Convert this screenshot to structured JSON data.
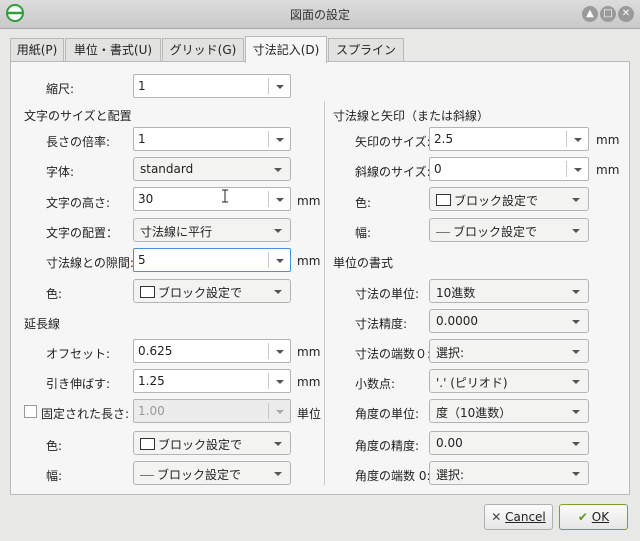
{
  "window": {
    "title": "図面の設定"
  },
  "tabs": [
    {
      "label": "用紙(P)"
    },
    {
      "label": "単位・書式(U)"
    },
    {
      "label": "グリッド(G)"
    },
    {
      "label": "寸法記入(D)",
      "active": true
    },
    {
      "label": "スプライン"
    }
  ],
  "scale": {
    "label": "縮尺:",
    "value": "1"
  },
  "text_section": {
    "title": "文字のサイズと配置",
    "length_factor": {
      "label": "長さの倍率:",
      "value": "1"
    },
    "font": {
      "label": "字体:",
      "value": "standard"
    },
    "text_height": {
      "label": "文字の高さ:",
      "value": "30",
      "unit": "mm"
    },
    "alignment": {
      "label": "文字の配置：",
      "value": "寸法線に平行"
    },
    "gap": {
      "label": "寸法線との隙間:",
      "value": "5",
      "unit": "mm"
    },
    "color": {
      "label": "色:",
      "value": "ブロック設定で"
    }
  },
  "extension_section": {
    "title": "延長線",
    "offset": {
      "label": "オフセット:",
      "value": "0.625",
      "unit": "mm"
    },
    "extend": {
      "label": "引き伸ばす:",
      "value": "1.25",
      "unit": "mm"
    },
    "fixed_length": {
      "label": "固定された長さ:",
      "value": "1.00",
      "unit": "単位",
      "checked": false
    },
    "color": {
      "label": "色:",
      "value": "ブロック設定で"
    },
    "width": {
      "label": "幅:",
      "value": "ブロック設定で"
    }
  },
  "arrow_section": {
    "title": "寸法線と矢印（または斜線）",
    "arrow_size": {
      "label": "矢印のサイズ:",
      "value": "2.5",
      "unit": "mm"
    },
    "tick_size": {
      "label": "斜線のサイズ:",
      "value": "0",
      "unit": "mm"
    },
    "color": {
      "label": "色:",
      "value": "ブロック設定で"
    },
    "width": {
      "label": "幅:",
      "value": "ブロック設定で"
    }
  },
  "format_section": {
    "title": "単位の書式",
    "dim_unit": {
      "label": "寸法の単位:",
      "value": "10進数"
    },
    "precision": {
      "label": "寸法精度:",
      "value": "0.0000"
    },
    "zero_suppress": {
      "label": "寸法の端数０:",
      "value": "選択:"
    },
    "decimal_point": {
      "label": "小数点:",
      "value": "'.' (ピリオド)"
    },
    "angle_unit": {
      "label": "角度の単位:",
      "value": "度（10進数）"
    },
    "angle_precision": {
      "label": "角度の精度:",
      "value": "0.00"
    },
    "angle_zero": {
      "label": "角度の端数 0:",
      "value": "選択:"
    }
  },
  "buttons": {
    "cancel": "Cancel",
    "ok": "OK"
  },
  "colors": {
    "ok_check": "#5a9a1a",
    "focus": "#4a90d9",
    "logo": "#2f9e3a"
  }
}
